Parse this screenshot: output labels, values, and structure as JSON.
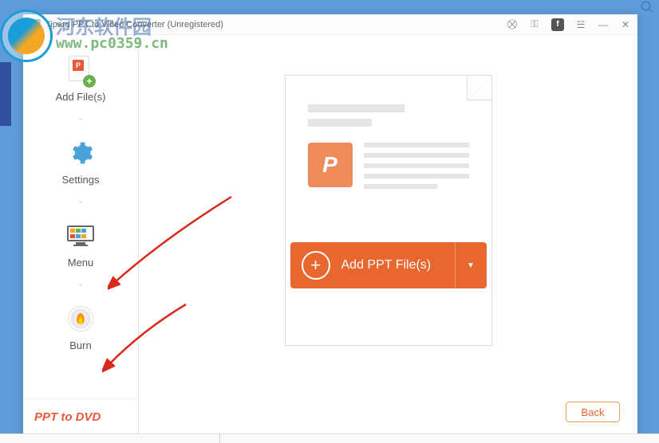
{
  "watermark": {
    "title": "河东软件园",
    "url": "www.pc0359.cn"
  },
  "titlebar": {
    "title": "Tipard PPT to Video Converter (Unregistered)"
  },
  "titlebar_icons": {
    "cart": "⛒",
    "key": "⚿",
    "fb": "f",
    "report": "☱",
    "min": "—",
    "close": "✕"
  },
  "sidebar": {
    "add_files": "Add File(s)",
    "settings": "Settings",
    "menu": "Menu",
    "burn": "Burn",
    "footer": "PPT to DVD"
  },
  "main": {
    "add_button": "Add PPT File(s)",
    "preview_letter": "P",
    "dropdown_glyph": "▼",
    "plus_glyph": "+"
  },
  "footer": {
    "back": "Back"
  },
  "menu_tile_colors": [
    "#f5a623",
    "#6ab04c",
    "#4aa3d8",
    "#e74c3c",
    "#4aa3d8",
    "#f5a623"
  ]
}
